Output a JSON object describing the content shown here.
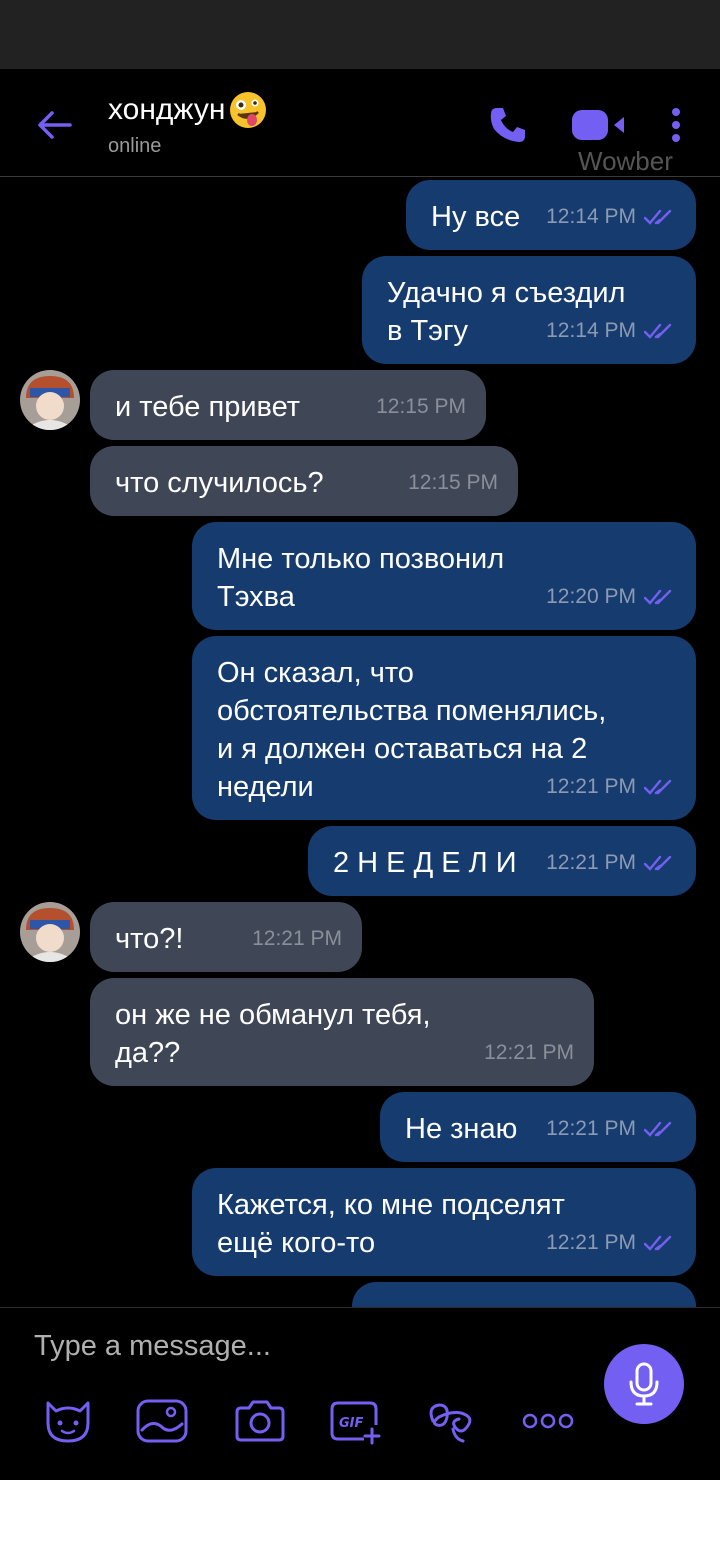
{
  "header": {
    "contact_name": "хонджун",
    "status": "online",
    "watermark": "Wowber"
  },
  "messages": [
    {
      "dir": "out",
      "text": "Ну все",
      "time": "12:14 PM"
    },
    {
      "dir": "out",
      "text": "Удачно я съездил\nв Тэгу",
      "time": "12:14 PM"
    },
    {
      "dir": "in",
      "text": "и тебе привет",
      "time": "12:15 PM"
    },
    {
      "dir": "in",
      "text": "что случилось?",
      "time": "12:15 PM"
    },
    {
      "dir": "out",
      "text": "Мне только позвонил\nТэхва",
      "time": "12:20 PM"
    },
    {
      "dir": "out",
      "text": "Он сказал, что\nобстоятельства поменялись,\nи я должен оставаться на 2\nнедели",
      "time": "12:21 PM"
    },
    {
      "dir": "out",
      "text": "2 Н Е Д Е Л И",
      "time": "12:21 PM"
    },
    {
      "dir": "in",
      "text": "что?!",
      "time": "12:21 PM"
    },
    {
      "dir": "in",
      "text": "он же не обманул тебя,\nда??",
      "time": "12:21 PM"
    },
    {
      "dir": "out",
      "text": "Не знаю",
      "time": "12:21 PM"
    },
    {
      "dir": "out",
      "text": "Кажется, ко мне подселят\nещё кого-то",
      "time": "12:21 PM"
    }
  ],
  "composer": {
    "placeholder": "Type a message...",
    "tools": [
      "sticker-icon",
      "gallery-icon",
      "camera-icon",
      "gif-icon",
      "doodle-icon",
      "more-icon"
    ]
  },
  "colors": {
    "accent": "#7360f2",
    "outgoing_bubble": "#163b6e",
    "incoming_bubble": "#3f4757",
    "background": "#000000"
  }
}
